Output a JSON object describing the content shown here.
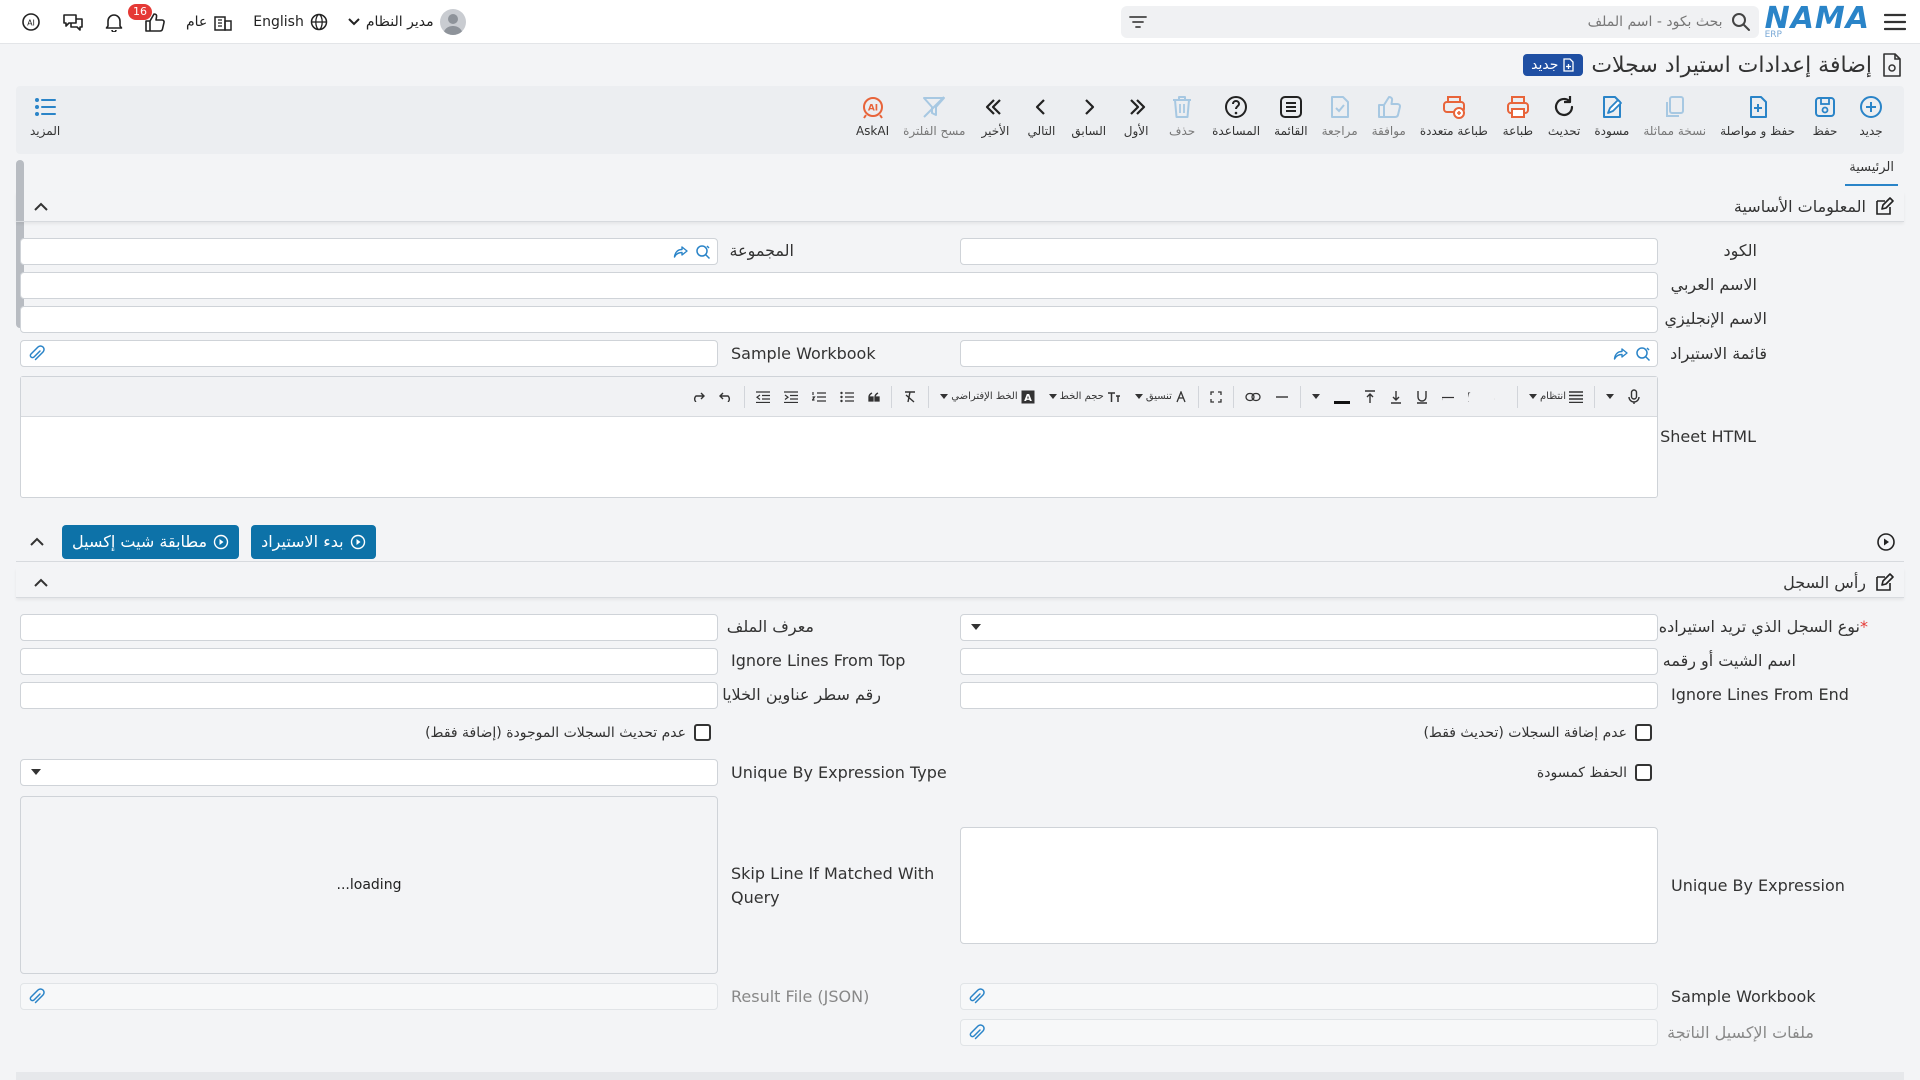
{
  "topbar": {
    "logo_main": "NAMA",
    "logo_sub": "ERP",
    "search_placeholder": "بحث بكود - اسم الملف",
    "user_name": "مدير النظام",
    "language": "English",
    "public_label": "عام",
    "notification_count": "16"
  },
  "page": {
    "title": "إضافة إعدادات استيراد سجلات",
    "new_badge": "جديد"
  },
  "toolbar": {
    "buttons": [
      {
        "label": "جديد",
        "icon": "plus-circle-icon",
        "disabled": false
      },
      {
        "label": "حفظ",
        "icon": "save-icon",
        "disabled": false
      },
      {
        "label": "حفظ و مواصلة",
        "icon": "save-continue-icon",
        "disabled": false
      },
      {
        "label": "نسخة مماثلة",
        "icon": "copy-icon",
        "disabled": true
      },
      {
        "label": "مسودة",
        "icon": "draft-icon",
        "disabled": false
      },
      {
        "label": "تحديث",
        "icon": "refresh-icon",
        "disabled": false
      },
      {
        "label": "طباعة",
        "icon": "print-icon",
        "disabled": false
      },
      {
        "label": "طباعة متعددة",
        "icon": "multi-print-icon",
        "disabled": false
      },
      {
        "label": "موافقة",
        "icon": "thumbs-up-icon",
        "disabled": true
      },
      {
        "label": "مراجعة",
        "icon": "review-icon",
        "disabled": true
      },
      {
        "label": "القائمة",
        "icon": "list-icon",
        "disabled": false
      },
      {
        "label": "المساعدة",
        "icon": "help-icon",
        "disabled": false
      },
      {
        "label": "حذف",
        "icon": "trash-icon",
        "disabled": true
      },
      {
        "label": "الأول",
        "icon": "first-icon",
        "disabled": false
      },
      {
        "label": "السابق",
        "icon": "previous-icon",
        "disabled": false
      },
      {
        "label": "التالي",
        "icon": "next-icon",
        "disabled": false
      },
      {
        "label": "الأخير",
        "icon": "last-icon",
        "disabled": false
      },
      {
        "label": "مسح الفلترة",
        "icon": "clear-filter-icon",
        "disabled": true
      },
      {
        "label": "AskAI",
        "icon": "ask-ai-icon",
        "disabled": false
      }
    ],
    "more_label": "المزيد"
  },
  "tabs": {
    "main": "الرئيسية"
  },
  "basic_info": {
    "title": "المعلومات الأساسية",
    "code_label": "الكود",
    "group_label": "المجموعة",
    "arabic_name_label": "الاسم العربي",
    "english_name_label": "الاسم الإنجليزي",
    "import_list_label": "قائمة الاستيراد",
    "sample_workbook_label": "Sample Workbook",
    "sheet_html_label": "Sheet HTML"
  },
  "editor": {
    "format_label": "انتظام",
    "font_size_label": "حجم الخط",
    "style_label": "تنسيق",
    "default_font_label": "الخط الإفتراضي"
  },
  "actions": {
    "start_import": "بدء الاستيراد",
    "match_sheet": "مطابقة شيت إكسيل"
  },
  "record_header": {
    "title": "رأس السجل",
    "record_type_label": "نوع السجل الذي تريد استيراده",
    "file_id_label": "معرف الملف",
    "sheet_name_label": "اسم الشيت أو رقمه",
    "ignore_top_label": "Ignore Lines From Top",
    "ignore_end_label": "Ignore Lines From End",
    "header_row_label": "رقم سطر عناوين الخلايا",
    "no_add_label": "عدم إضافة السجلات (تحديث فقط)",
    "no_update_label": "عدم تحديث السجلات الموجودة (إضافة فقط)",
    "save_draft_label": "الحفظ كمسودة",
    "unique_type_label": "Unique By Expression Type",
    "unique_expr_label": "Unique By Expression",
    "skip_line_label_1": "Skip Line If Matched With",
    "skip_line_label_2": "Query",
    "loading_text": "loading...",
    "sample_workbook_label": "Sample Workbook",
    "result_file_label": "Result File (JSON)",
    "result_excel_label": "ملفات الإكسيل الناتجة"
  }
}
